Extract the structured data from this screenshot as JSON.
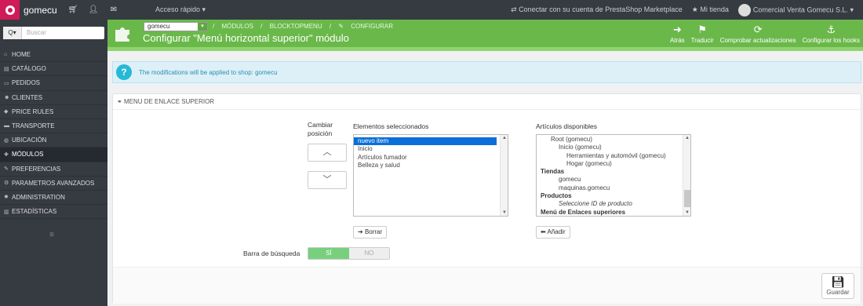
{
  "topbar": {
    "brand": "gomecu",
    "quick_access": "Acceso rápido",
    "marketplace": "Conectar con su cuenta de PrestaShop Marketplace",
    "my_shop": "Mi tienda",
    "user": "Comercial  Venta Gomecu S.L."
  },
  "sidebar": {
    "search_placeholder": "Buscar",
    "items": [
      {
        "label": "HOME",
        "icon": "home-icon"
      },
      {
        "label": "CATÁLOGO",
        "icon": "catalog-icon"
      },
      {
        "label": "PEDIDOS",
        "icon": "orders-icon"
      },
      {
        "label": "CLIENTES",
        "icon": "customers-icon"
      },
      {
        "label": "PRICE RULES",
        "icon": "price-rules-icon"
      },
      {
        "label": "TRANSPORTE",
        "icon": "truck-icon"
      },
      {
        "label": "UBICACIÓN",
        "icon": "globe-icon"
      },
      {
        "label": "MÓDULOS",
        "icon": "puzzle-icon"
      },
      {
        "label": "PREFERENCIAS",
        "icon": "wrench-icon"
      },
      {
        "label": "PARAMETROS AVANZADOS",
        "icon": "cogs-icon"
      },
      {
        "label": "ADMINISTRATION",
        "icon": "gear-icon"
      },
      {
        "label": "ESTADÍSTICAS",
        "icon": "stats-icon"
      }
    ]
  },
  "header": {
    "shop_select": "gomecu",
    "breadcrumb": [
      "MÓDULOS",
      "BLOCKTOPMENU",
      "CONFIGURAR"
    ],
    "title": "Configurar \"Menú horizontal superior\" módulo",
    "toolbar": [
      "Atrás",
      "Traducir",
      "Comprobar actualizaciones",
      "Configurar los hooks"
    ]
  },
  "alert": {
    "text": "The modifications will be applied to shop: gomecu"
  },
  "panel": {
    "heading": "MENU DE ENLACE SUPERIOR",
    "change_position": "Cambiar posición",
    "selected_label": "Elementos seleccionados",
    "available_label": "Artículos disponibles",
    "selected_items": [
      "nuevo item",
      "Inicio",
      "Artículos fumador",
      "Belleza y salud"
    ],
    "available_items": [
      {
        "text": "Root (gomecu)",
        "indent": 1,
        "style": "normal"
      },
      {
        "text": "Inicio (gomecu)",
        "indent": 2,
        "style": "normal"
      },
      {
        "text": "Herramientas y automóvil (gomecu)",
        "indent": 3,
        "style": "normal"
      },
      {
        "text": "Hogar (gomecu)",
        "indent": 3,
        "style": "normal"
      },
      {
        "text": "Tiendas",
        "indent": 0,
        "style": "bold"
      },
      {
        "text": "gomecu",
        "indent": 2,
        "style": "normal"
      },
      {
        "text": "maquinas.gomecu",
        "indent": 2,
        "style": "normal"
      },
      {
        "text": "Productos",
        "indent": 0,
        "style": "bold"
      },
      {
        "text": "Seleccione ID de producto",
        "indent": 2,
        "style": "italic"
      },
      {
        "text": "Menú de Enlaces superiores",
        "indent": 0,
        "style": "bold"
      }
    ],
    "remove_button": "Borrar",
    "add_button": "Añadir",
    "search_bar_label": "Barra de búsqueda",
    "toggle_on": "SÍ",
    "toggle_off": "NO",
    "save_button": "Guardar"
  }
}
